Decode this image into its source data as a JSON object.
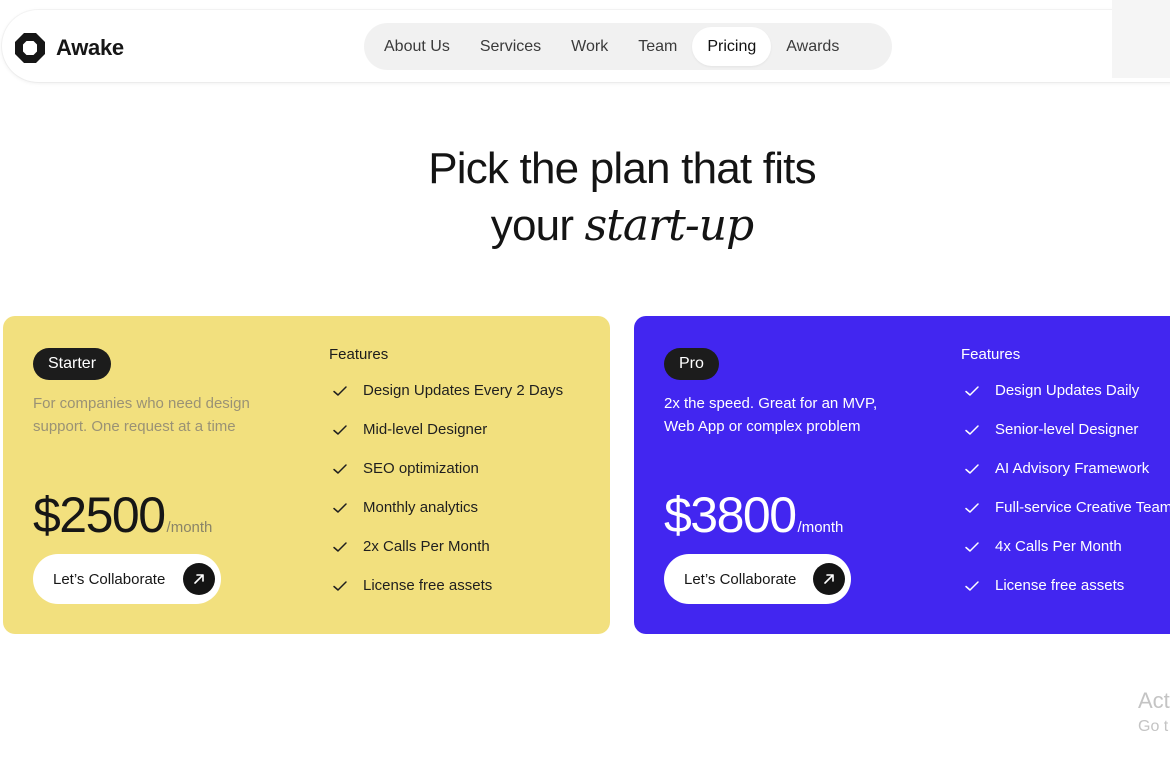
{
  "brand": {
    "name": "Awake",
    "icon": "octagon-logo-icon"
  },
  "nav": {
    "items": [
      {
        "label": "About Us",
        "active": false
      },
      {
        "label": "Services",
        "active": false
      },
      {
        "label": "Work",
        "active": false
      },
      {
        "label": "Team",
        "active": false
      },
      {
        "label": "Pricing",
        "active": true
      },
      {
        "label": "Awards",
        "active": false
      }
    ]
  },
  "hero": {
    "line1": "Pick the plan that fits",
    "line2_plain": "your",
    "line2_italic": "start-up"
  },
  "plans": [
    {
      "badge": "Starter",
      "description": "For companies who need design support. One request at a time",
      "price": "$2500",
      "price_unit": "/month",
      "cta_label": "Let’s Collaborate",
      "features_title": "Features",
      "features": [
        "Design Updates Every 2 Days",
        "Mid-level Designer",
        "SEO optimization",
        "Monthly analytics",
        "2x Calls Per Month",
        "License free assets"
      ],
      "background": "#f2e07e"
    },
    {
      "badge": "Pro",
      "description": "2x the speed. Great for an MVP, Web App or complex problem",
      "price": "$3800",
      "price_unit": "/month",
      "cta_label": "Let’s Collaborate",
      "features_title": "Features",
      "features": [
        "Design Updates Daily",
        "Senior-level Designer",
        "AI Advisory Framework",
        "Full-service Creative Team",
        "4x Calls Per Month",
        "License free assets"
      ],
      "background": "#4226f0"
    }
  ],
  "watermark": {
    "line1": "Act",
    "line2": "Go t"
  },
  "colors": {
    "dark": "#141414",
    "nav_bg": "#f1f1f1",
    "starter_bg": "#f2e07e",
    "pro_bg": "#4226f0"
  }
}
